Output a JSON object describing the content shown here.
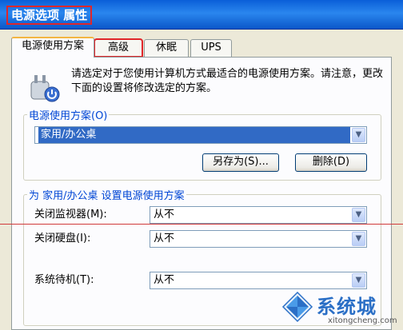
{
  "window": {
    "title": "电源选项 属性"
  },
  "tabs": [
    {
      "label": "电源使用方案",
      "active": true
    },
    {
      "label": "高级",
      "active": false,
      "highlighted": true
    },
    {
      "label": "休眠",
      "active": false
    },
    {
      "label": "UPS",
      "active": false
    }
  ],
  "intro": {
    "icon": "power-plug-icon",
    "text": "请选定对于您使用计算机方式最适合的电源使用方案。请注意，更改下面的设置将修改选定的方案。"
  },
  "scheme_group": {
    "legend": "电源使用方案(O)",
    "selected_value": "家用/办公桌",
    "save_as_label": "另存为(S)...",
    "delete_label": "删除(D)"
  },
  "settings_group": {
    "legend": "为 家用/办公桌 设置电源使用方案",
    "rows": [
      {
        "label": "关闭监视器(M):",
        "value": "从不"
      },
      {
        "label": "关闭硬盘(I):",
        "value": "从不"
      },
      {
        "label": "系统待机(T):",
        "value": "从不"
      }
    ]
  },
  "watermark": {
    "text": "系统城",
    "url": "xitongcheng.com",
    "logo": "windows-logo-icon"
  },
  "colors": {
    "titlebar": "#0a5fd8",
    "annotation_red": "#e0262a",
    "legend_blue": "#0046d5",
    "selection_blue": "#316ac5"
  }
}
